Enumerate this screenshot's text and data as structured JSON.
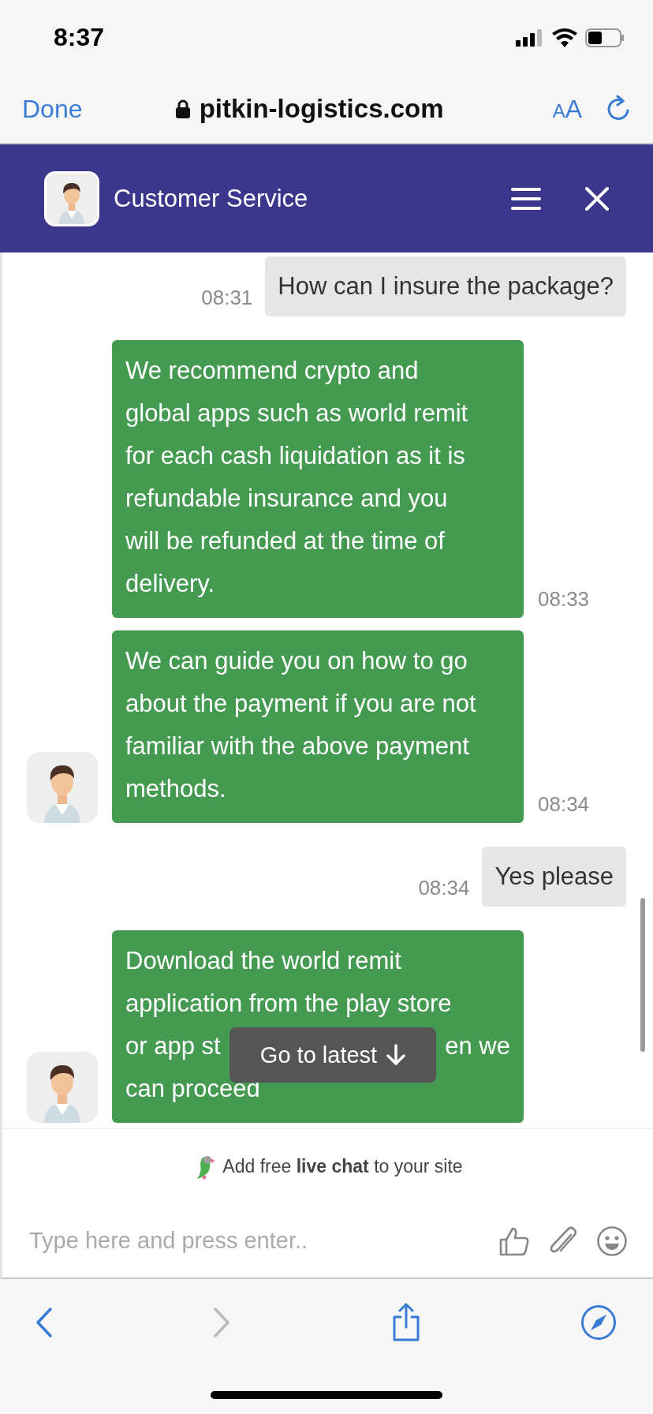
{
  "status_bar": {
    "time": "8:37"
  },
  "browser": {
    "done": "Done",
    "url": "pitkin-logistics.com",
    "text_size_letters": [
      "A",
      "A"
    ]
  },
  "chat": {
    "title": "Customer Service",
    "messages": [
      {
        "kind": "visitor",
        "text": "How can I insure the package?",
        "time": "08:31"
      },
      {
        "kind": "agent",
        "avatar": false,
        "text": "We recommend crypto and global apps such as world remit for each cash liquidation as it is refundable insurance and you will be refunded at the time of delivery.",
        "time": "08:33"
      },
      {
        "kind": "agent",
        "avatar": true,
        "text": "We can guide you on how to go about the payment if you are not familiar with the above payment methods.",
        "time": "08:34"
      },
      {
        "kind": "visitor",
        "text": "Yes please",
        "time": "08:34"
      },
      {
        "kind": "agent",
        "avatar": true,
        "lines": [
          [
            "Download the world remit"
          ],
          [
            "application from the play store"
          ],
          [
            "or app st",
            "en we"
          ],
          [
            "can proceed"
          ]
        ]
      }
    ],
    "go_to_latest": "Go to latest",
    "branding": "Add free **live chat** to your site",
    "input": {
      "placeholder": "Type here and press enter.."
    }
  },
  "toolbar": {
    "back": {
      "disabled": false
    },
    "forward": {
      "disabled": true
    }
  }
}
